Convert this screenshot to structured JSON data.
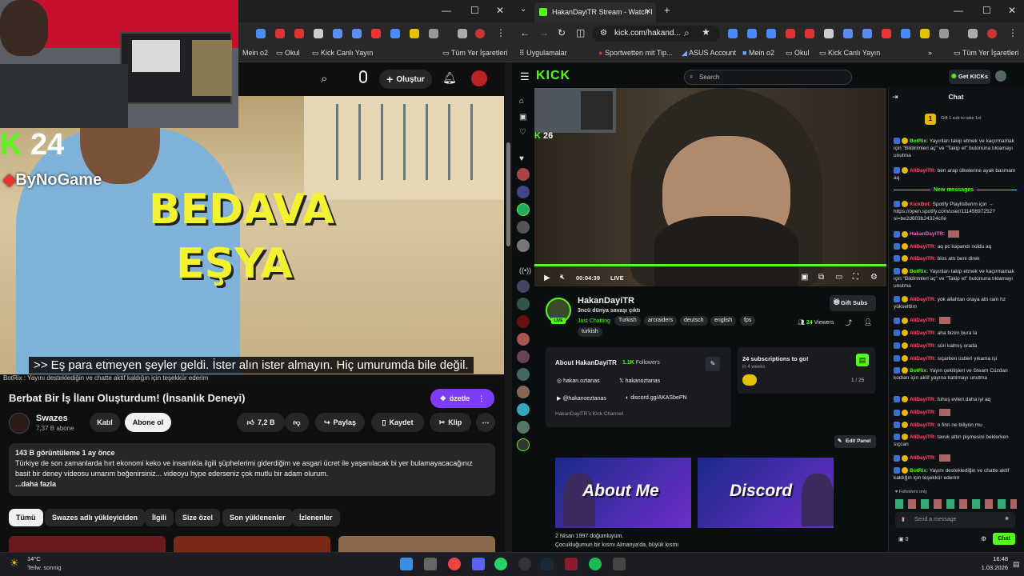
{
  "left_window": {
    "bookmarks": [
      "Mein o2",
      "Okul",
      "Kick Canlı Yayın",
      "Tüm Yer İşaretleri"
    ],
    "create_label": "Oluştur",
    "overlay_count": "24",
    "overlay_brand": "ByNoGame",
    "video_headline_1": "BEDAVA",
    "video_headline_2": "EŞYA",
    "subtitle": ">> Eş para etmeyen şeyler geldi. İster alın ister almayın. Hiç umurumda bile değil.",
    "ticker": "BotRix : Yayını desteklediğin ve chatte aktif kaldığın için teşekkür ederim",
    "title": "Berbat Bir İş İlanı Oluşturdum! (İnsanlık Deneyi)",
    "summarize_label": "özetle",
    "channel": "Swazes",
    "subscribers": "7,37 B abone",
    "join_label": "Katıl",
    "subscribe_label": "Abone ol",
    "likes": "7,2 B",
    "share_label": "Paylaş",
    "save_label": "Kaydet",
    "clip_label": "Klip",
    "views_date": "143 B görüntüleme  1 ay önce",
    "description": "Türkiye de son zamanlarda hırt ekonomi keko ve insanlıkla ilgili şüphelerimi giderdiğim ve asgari ücret ile yaşanılacak bi yer bulamayacacağınız basit bir deney videosu umarım beğenirsiniz... videoyu hype ederseniz çok mutlu bir adam olurum.",
    "more_label": "...daha fazla",
    "chips": [
      "Tümü",
      "Swazes adlı yükleyiciden",
      "İlgili",
      "Size özel",
      "Son yüklenenler",
      "İzlenenler"
    ]
  },
  "right_window": {
    "tab_title": "HakanDayiTR Stream - Watch I",
    "url": "kick.com/hakand...",
    "bookmarks": [
      "Uygulamalar",
      "Sportwetten mit Tip...",
      "ASUS Account",
      "Mein o2",
      "Okul",
      "Kick Canlı Yayın",
      "Tüm Yer İşaretleri"
    ],
    "search_placeholder": "Search",
    "get_kicks": "Get KICKs",
    "cam_count": "26",
    "time": "00:04:39",
    "live": "LIVE",
    "streamer": "HakanDayiTR",
    "stream_title": "3ncü dünya savaşı çıktı",
    "category": "Just Chatting",
    "tags": [
      "Turkish",
      "arcraiders",
      "deutsch",
      "english",
      "fps",
      "turkish"
    ],
    "gift_subs": "Gift Subs",
    "viewers": "24",
    "viewers_label": "Viewers",
    "about_title": "About HakanDayiTR",
    "followers": "1.1K",
    "followers_label": "Followers",
    "socials": [
      "hakan.oztanas",
      "hakanoztanas",
      "@hakanoeztanas",
      "discord.gg/AKASbePN"
    ],
    "channel_name": "HakanDayiTR's Kick Channel",
    "sub_goal": "24 subscriptions to go!",
    "sub_goal_time": "in 4 weeks",
    "sub_goal_progress": "1 / 25",
    "edit_panel": "Edit Panel",
    "panel1": "About Me",
    "panel2": "Discord",
    "bio_1": "2 Nisan 1997 doğumluyum.",
    "bio_2": "Çocukluğumun bir kısmı Almanya'da, büyük kısmı",
    "chat_title": "Chat",
    "gift_banner": "Gift 1 sub to take 1st",
    "new_messages": "New messages",
    "followers_only": "Followers only",
    "send_placeholder": "Send a message",
    "chat_button": "Chat",
    "chat_count": "0",
    "messages": [
      {
        "user": "BotRix:",
        "color": "#53fc18",
        "text": "Yayınları takip etmek ve kaçırmamak için \"Bildirimleri aç\" ve \"Takip et\" butonuna tıklamayı unutma"
      },
      {
        "user": "AliDayiTR:",
        "color": "#ff4d6d",
        "text": "ben arap ülkelerine ayak basmam aq"
      },
      {
        "user": "KickBot:",
        "color": "#ff4d6d",
        "text": "Spotify Playlistlerim için → https://open.spotify.com/user/11145697252?si=be2d603b24324c0e"
      },
      {
        "user": "HakanDayiTR:",
        "color": "#ff5ad1",
        "text": ""
      },
      {
        "user": "AliDayiTR:",
        "color": "#ff4d6d",
        "text": "aq pc kapandı noldu aq"
      },
      {
        "user": "AliDayiTR:",
        "color": "#ff4d6d",
        "text": "bios attı beni direk"
      },
      {
        "user": "BotRix:",
        "color": "#53fc18",
        "text": "Yayınları takip etmek ve kaçırmamak için \"Bildirimleri aç\" ve \"Takip et\" butonuna tıklamayı unutma"
      },
      {
        "user": "AliDayiTR:",
        "color": "#ff4d6d",
        "text": "yok allahtan oraya attı ram hz yükselttim"
      },
      {
        "user": "AliDayiTR:",
        "color": "#ff4d6d",
        "text": ""
      },
      {
        "user": "AliDayiTR:",
        "color": "#ff4d6d",
        "text": "aha bizim bura la"
      },
      {
        "user": "AliDayiTR:",
        "color": "#ff4d6d",
        "text": "süri kalmış orada"
      },
      {
        "user": "AliDayiTR:",
        "color": "#ff4d6d",
        "text": "sıçarken üstleri yıkama işi"
      },
      {
        "user": "BotRix:",
        "color": "#53fc18",
        "text": "Yayın çekilişleri ve Steam Cüzdan kodları için aktif yayına katılmayı unutma"
      },
      {
        "user": "AliDayiTR:",
        "color": "#ff4d6d",
        "text": "fuhuş evleri daha iyi aq"
      },
      {
        "user": "AliDayiTR:",
        "color": "#ff4d6d",
        "text": ""
      },
      {
        "user": "AliDayiTR:",
        "color": "#ff4d6d",
        "text": "o finn ne biliyon mu"
      },
      {
        "user": "AliDayiTR:",
        "color": "#ff4d6d",
        "text": "tavuk attın pişmesini beklerken sıçcan"
      },
      {
        "user": "AliDayiTR:",
        "color": "#ff4d6d",
        "text": ""
      },
      {
        "user": "BotRix:",
        "color": "#53fc18",
        "text": "Yayını desteklediğin ve chatte aktif kaldığın için teşekkür ederim"
      }
    ]
  },
  "taskbar": {
    "temp": "14°C",
    "weather": "Teilw. sonnig",
    "time": "16:48",
    "date": "1.03.2026"
  },
  "colors": {
    "kick_green": "#53fc18",
    "yt_purple": "#7e3cf6"
  }
}
